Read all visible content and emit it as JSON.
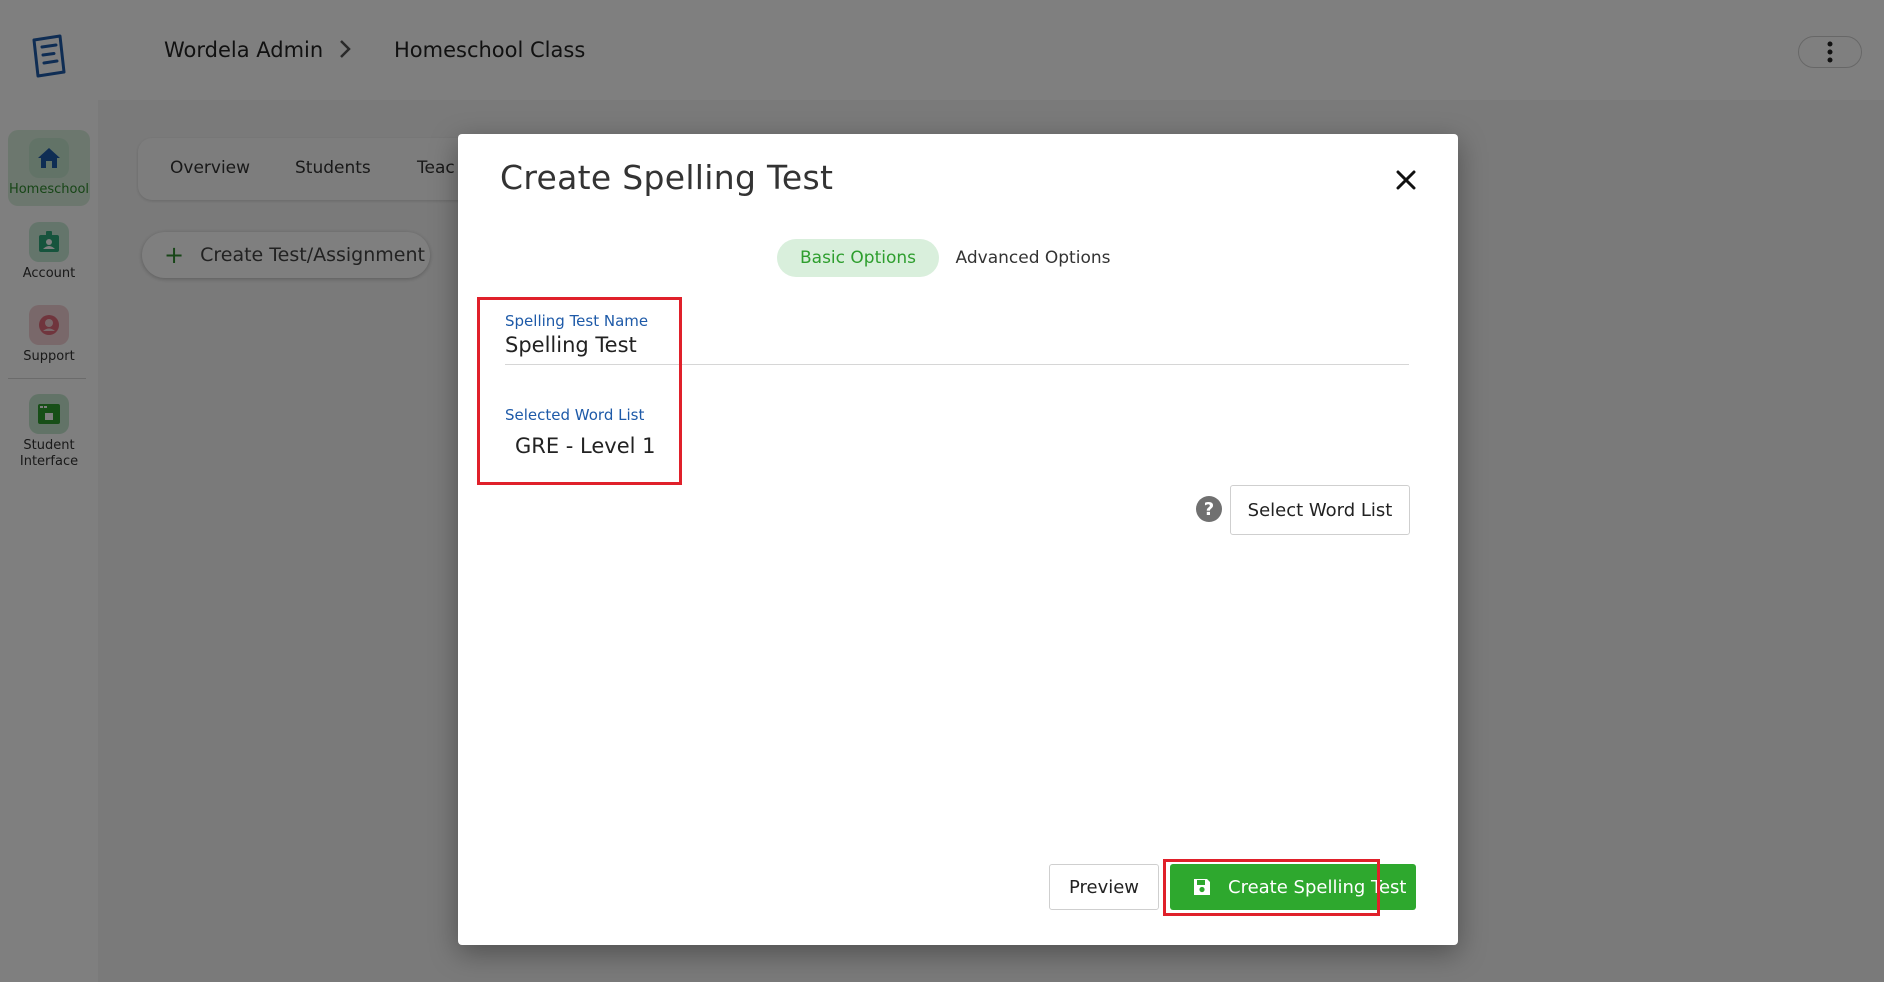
{
  "breadcrumb": {
    "root": "Wordela Admin",
    "current": "Homeschool Class"
  },
  "sidebar": {
    "items": [
      {
        "label": "Homeschool",
        "icon": "home-icon",
        "active": true
      },
      {
        "label": "Account",
        "icon": "account-badge-icon"
      },
      {
        "label": "Support",
        "icon": "support-icon"
      },
      {
        "label": "Student Interface",
        "icon": "student-interface-icon"
      }
    ]
  },
  "class_tabs": [
    "Overview",
    "Students",
    "Teac"
  ],
  "create_button_label": "Create Test/Assignment",
  "modal": {
    "title": "Create Spelling Test",
    "tabs": {
      "basic": "Basic Options",
      "advanced": "Advanced Options"
    },
    "name_field": {
      "label": "Spelling Test Name",
      "value": "Spelling Test"
    },
    "word_list": {
      "label": "Selected Word List",
      "value": "GRE - Level 1"
    },
    "select_word_list_label": "Select Word List",
    "help_symbol": "?",
    "preview_label": "Preview",
    "create_label": "Create Spelling Test"
  },
  "colors": {
    "accent_green": "#2ea82e",
    "link_blue": "#1e5aa8",
    "highlight_red": "#e0202a"
  }
}
